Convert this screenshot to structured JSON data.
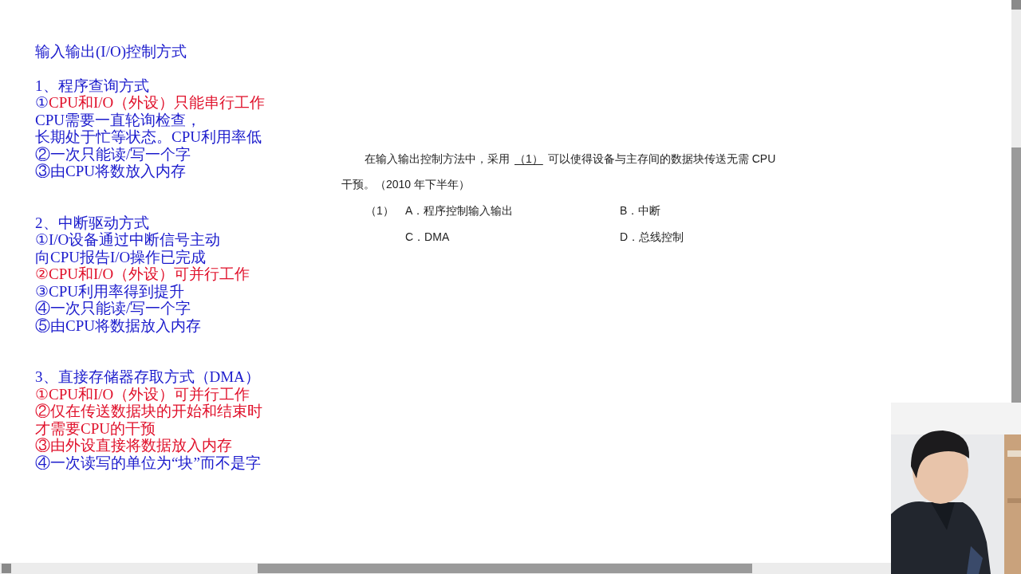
{
  "notes": {
    "title": "输入输出(I/O)控制方式",
    "sections": [
      {
        "heading": "1、程序查询方式",
        "lines": [
          [
            {
              "text": "①",
              "color": "#1a1acc"
            },
            {
              "text": "CPU和I/O（外设）只能串行工作",
              "color": "#e0102a"
            }
          ],
          [
            {
              "text": "CPU需要一直轮询检查，",
              "color": "#1a1acc"
            }
          ],
          [
            {
              "text": "长期处于忙等状态。CPU利用率低",
              "color": "#1a1acc"
            }
          ],
          [
            {
              "text": "②一次只能读/写一个字",
              "color": "#1a1acc"
            }
          ],
          [
            {
              "text": "③由CPU将数放入内存",
              "color": "#1a1acc"
            }
          ]
        ]
      },
      {
        "heading": "2、中断驱动方式",
        "lines": [
          [
            {
              "text": "①I/O设备通过中断信号主动",
              "color": "#1a1acc"
            }
          ],
          [
            {
              "text": "向CPU报告I/O操作已完成",
              "color": "#1a1acc"
            }
          ],
          [
            {
              "text": "②CPU和I/O（外设）可并行工作",
              "color": "#e0102a"
            }
          ],
          [
            {
              "text": "③CPU利用率得到提升",
              "color": "#1a1acc"
            }
          ],
          [
            {
              "text": "④一次只能读/写一个字",
              "color": "#1a1acc"
            }
          ],
          [
            {
              "text": "⑤由CPU将数据放入内存",
              "color": "#1a1acc"
            }
          ]
        ]
      },
      {
        "heading": "3、直接存储器存取方式（DMA）",
        "lines": [
          [
            {
              "text": "①CPU和I/O（外设）可并行工作",
              "color": "#e0102a"
            }
          ],
          [
            {
              "text": "②仅在传送数据块的开始和结束时",
              "color": "#e0102a"
            }
          ],
          [
            {
              "text": "才需要CPU的干预",
              "color": "#e0102a"
            }
          ],
          [
            {
              "text": "③由外设直接将数据放入内存",
              "color": "#e0102a"
            }
          ],
          [
            {
              "text": "④一次读写的单位为“块”而不是字",
              "color": "#1a1acc"
            }
          ]
        ]
      }
    ]
  },
  "question": {
    "before": "在输入输出控制方法中，采用",
    "blank": "（1）",
    "after": "可以使得设备与主存间的数据块传送无需 CPU",
    "line2": "干预。（2010 年下半年）",
    "number": "（1）",
    "options": [
      "A．程序控制输入输出",
      "B．中断",
      "C．DMA",
      "D．总线控制"
    ]
  }
}
